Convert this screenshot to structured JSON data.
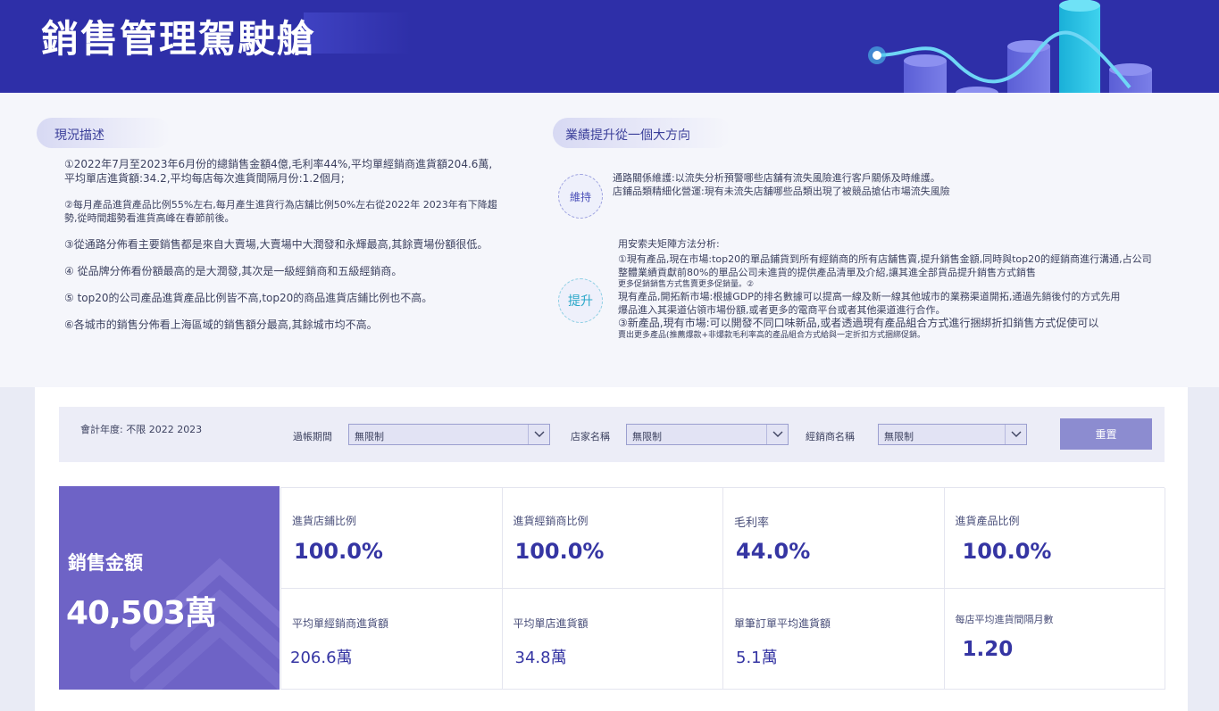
{
  "header": {
    "title": "銷售管理駕駛艙"
  },
  "status": {
    "title": "現況描述",
    "items": [
      "①2022年7月至2023年6月份的總銷售金額4億,毛利率44%,平均單經銷商進貨額204.6萬,平均單店進貨額:34.2,平均每店每次進貨間隔月份:1.2個月;",
      "②每月產品進貨產品比例55%左右,每月產生進貨行為店舖比例50%左右從2022年 2023年有下降趨勢,從時間趨勢看進貨高峰在春節前後。",
      "③從通路分佈看主要銷售都是來自大賣場,大賣場中大潤發和永輝最高,其餘賣場份額很低。",
      "④ 從品牌分佈看份額最高的是大潤發,其次是一級經銷商和五級經銷商。",
      "⑤ top20的公司產品進貨產品比例皆不高,top20的商品進貨店鋪比例也不高。",
      "⑥各城市的銷售分佈看上海區域的銷售額分最高,其餘城市均不高。"
    ]
  },
  "direction": {
    "title": "業績提升從一個大方向",
    "maintain_badge": "維持",
    "maintain_lines": [
      "通路關係維護:以流失分析預警哪些店舖有流失風險進行客戶關係及時維護。",
      "店鋪品類精細化營運:現有未流失店舖哪些品類出現了被競品搶佔市場流失風險"
    ],
    "boost_badge": "提升",
    "boost_intro": "用安索夫矩陣方法分析:",
    "boost_line1": "①現有產品,現在市場:top20的單品鋪貨到所有經銷商的所有店舖售賣,提升銷售金額,同時與top20的經銷商進行溝通,占公司整體業績貢獻前80%的單品公司未進貨的提供產品清單及介紹,讓其進全部貨品提升銷售方式銷售",
    "boost_line1b": "更多促銷銷售方式售賣更多促銷量。②",
    "boost_line2": "現有產品,開拓新市場:根據GDP的排名數據可以提高一線及新一線其他城市的業務渠道開拓,通過先銷後付的方式先用",
    "boost_line2b": "爆品進入其渠道佔領市場份額,或者更多的電商平台或者其他渠道進行合作。",
    "boost_line3": "③新產品,現有市場:可以開發不同口味新品,或者透過現有產品組合方式進行捆綁折扣銷售方式促使可以",
    "boost_line3b": "賣出更多產品(推薦爆款+非爆款毛利率高的產品組合方式給與一定折扣方式捆綁促銷。"
  },
  "filters": {
    "fiscal": "會計年度: 不限 2022 2023",
    "period_label": "過帳期間",
    "period_value": "無限制",
    "store_label": "店家名稱",
    "store_value": "無限制",
    "dealer_label": "經銷商名稱",
    "dealer_value": "無限制",
    "reset_label": "重置"
  },
  "kpi": {
    "sales_label": "銷售金額",
    "sales_value": "40,503萬",
    "cells": [
      {
        "label": "進貨店鋪比例",
        "value": "100.0%"
      },
      {
        "label": "進貨經銷商比例",
        "value": "100.0%"
      },
      {
        "label": "毛利率",
        "value": "44.0%"
      },
      {
        "label": "進貨產品比例",
        "value": "100.0%"
      },
      {
        "label": "平均單經銷商進貨額",
        "value": "206.6萬"
      },
      {
        "label": "平均單店進貨額",
        "value": "34.8萬"
      },
      {
        "label": "單筆訂單平均進貨額",
        "value": "5.1萬"
      },
      {
        "label": "每店平均進貨間隔月數",
        "value": "1.20"
      }
    ]
  },
  "colors": {
    "header": "#2e2fa8",
    "sales_card": "#6e63c6",
    "kpi_value": "#3535a3",
    "reset_button": "#8c8cd0"
  }
}
